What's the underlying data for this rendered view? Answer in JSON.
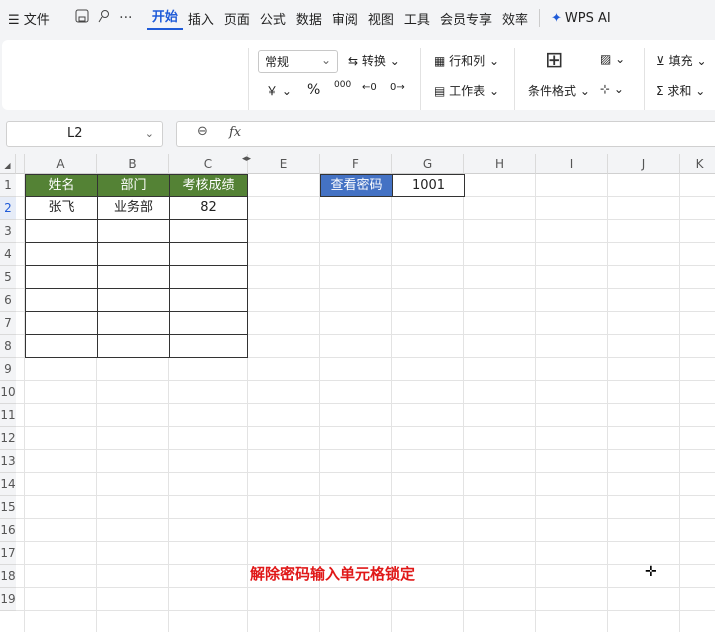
{
  "menu": {
    "file_icon": "☰",
    "file_label": "文件",
    "quick_icons": [
      "save-icon",
      "paint-icon",
      "more-icon"
    ],
    "tabs": [
      "开始",
      "插入",
      "页面",
      "公式",
      "数据",
      "审阅",
      "视图",
      "工具",
      "会员专享",
      "效率"
    ],
    "active_tab": "开始",
    "wps_ai": "WPS AI"
  },
  "ribbon": {
    "number_format": "常规",
    "convert": "转换",
    "rows_cols": "行和列",
    "worksheet": "工作表",
    "cond_format": "条件格式",
    "fill": "填充",
    "sum": "求和",
    "currency_symbol": "￥",
    "percent_symbol": "%",
    "thousands_symbol": "000",
    "dec_inc_symbol": "←0",
    "dec_dec_symbol": "0→",
    "grid_symbol": "⊞",
    "sigma_symbol": "Σ"
  },
  "formula_bar": {
    "name_box": "L2",
    "fx": "fx",
    "formula": ""
  },
  "sheet": {
    "columns": [
      "A",
      "B",
      "C",
      "E",
      "F",
      "G",
      "H",
      "I",
      "J",
      "K"
    ],
    "rows": [
      "1",
      "2",
      "3",
      "4",
      "5",
      "6",
      "7",
      "8",
      "9",
      "10",
      "11",
      "12",
      "13",
      "14",
      "15",
      "16",
      "17",
      "18",
      "19"
    ],
    "headers": [
      "姓名",
      "部门",
      "考核成绩"
    ],
    "row2": [
      "张飞",
      "业务部",
      "82"
    ],
    "lookup_label": "查看密码",
    "lookup_value": "1001"
  },
  "notice": "解除密码输入单元格锁定",
  "colors": {
    "header_green": "#548235",
    "button_blue": "#4472c4",
    "accent": "#1f5bd8",
    "notice_red": "#e01818"
  }
}
